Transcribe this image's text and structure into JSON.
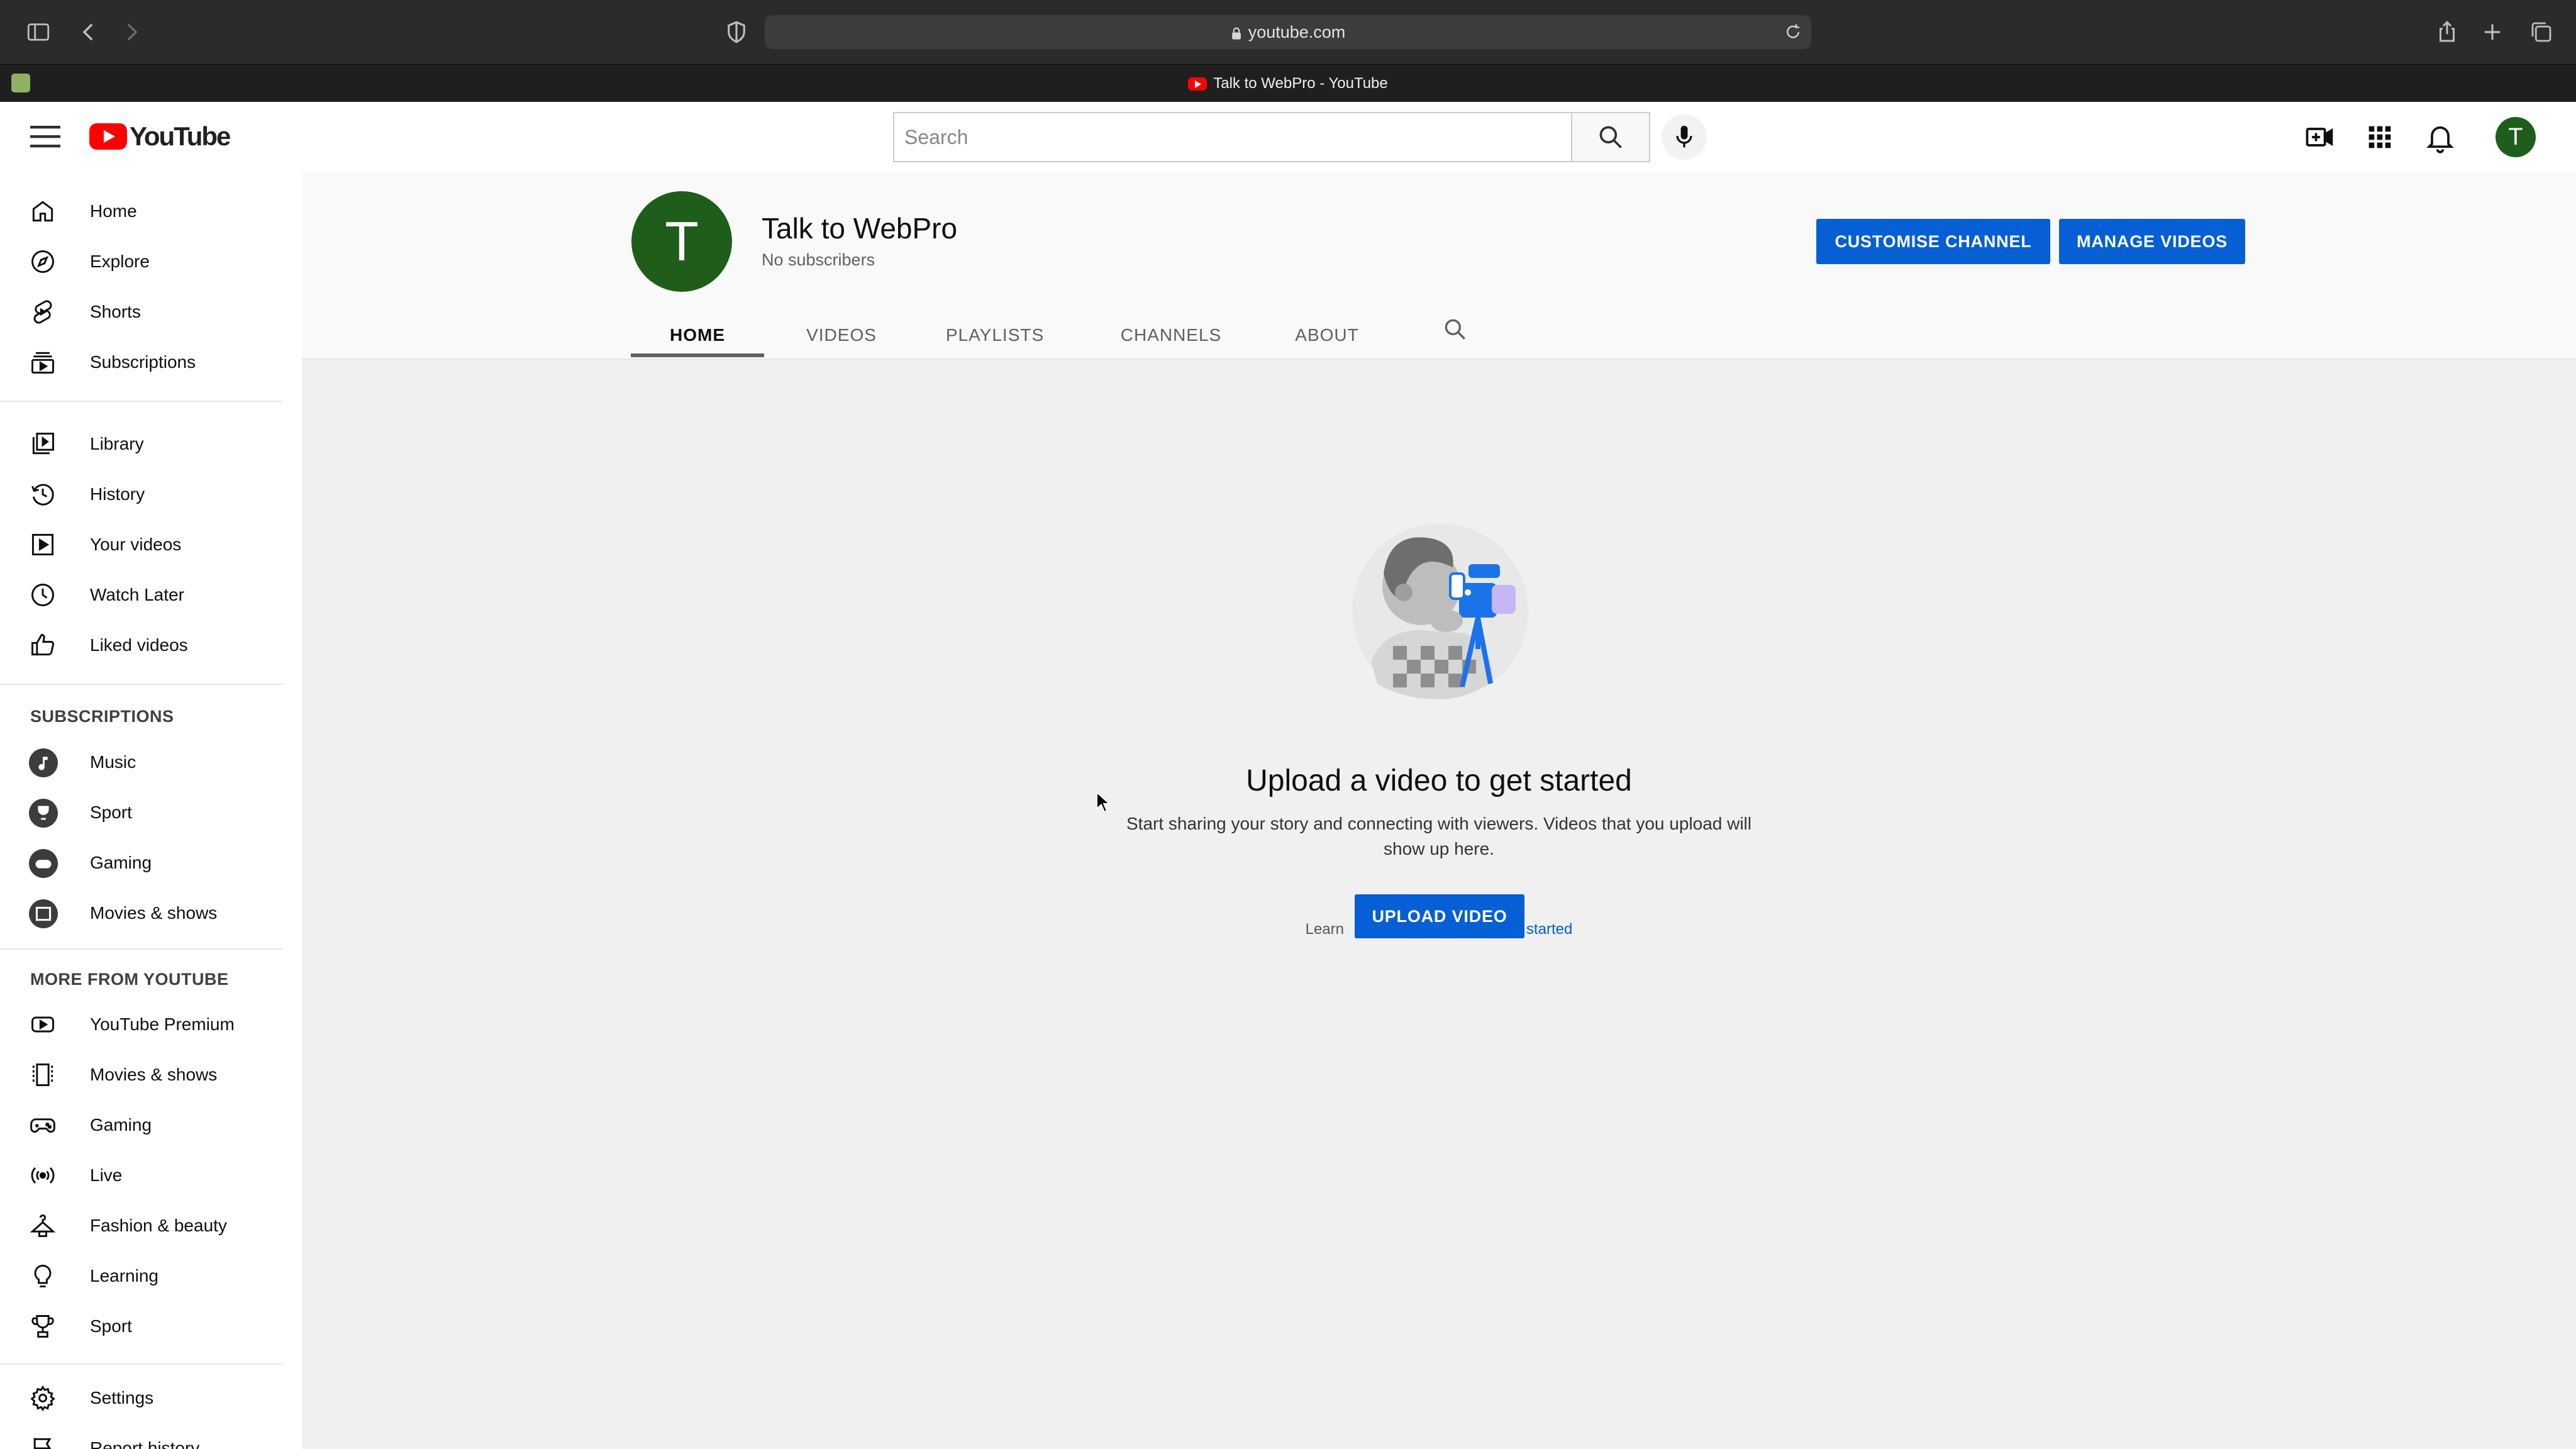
{
  "browser": {
    "url": "youtube.com",
    "tab_title": "Talk to WebPro - YouTube"
  },
  "masthead": {
    "logo_text": "YouTube",
    "search_placeholder": "Search",
    "avatar_letter": "T"
  },
  "sidebar": {
    "main": [
      {
        "label": "Home",
        "icon": "home-icon"
      },
      {
        "label": "Explore",
        "icon": "compass-icon"
      },
      {
        "label": "Shorts",
        "icon": "shorts-icon"
      },
      {
        "label": "Subscriptions",
        "icon": "subscriptions-icon"
      }
    ],
    "library": [
      {
        "label": "Library",
        "icon": "library-icon"
      },
      {
        "label": "History",
        "icon": "history-icon"
      },
      {
        "label": "Your videos",
        "icon": "your-videos-icon"
      },
      {
        "label": "Watch Later",
        "icon": "clock-icon"
      },
      {
        "label": "Liked videos",
        "icon": "thumbs-up-icon"
      }
    ],
    "subscriptions_heading": "SUBSCRIPTIONS",
    "subscriptions": [
      {
        "label": "Music",
        "icon": "music-channel-icon"
      },
      {
        "label": "Sport",
        "icon": "sport-channel-icon"
      },
      {
        "label": "Gaming",
        "icon": "gaming-channel-icon"
      },
      {
        "label": "Movies & shows",
        "icon": "movies-channel-icon"
      }
    ],
    "more_heading": "MORE FROM YOUTUBE",
    "more": [
      {
        "label": "YouTube Premium",
        "icon": "youtube-premium-icon"
      },
      {
        "label": "Movies & shows",
        "icon": "film-strip-icon"
      },
      {
        "label": "Gaming",
        "icon": "gamepad-icon"
      },
      {
        "label": "Live",
        "icon": "live-icon"
      },
      {
        "label": "Fashion & beauty",
        "icon": "hanger-icon"
      },
      {
        "label": "Learning",
        "icon": "lightbulb-icon"
      },
      {
        "label": "Sport",
        "icon": "trophy-icon"
      }
    ],
    "settings": [
      {
        "label": "Settings",
        "icon": "gear-icon"
      },
      {
        "label": "Report history",
        "icon": "flag-icon"
      }
    ]
  },
  "channel": {
    "avatar_letter": "T",
    "name": "Talk to WebPro",
    "subscribers": "No subscribers",
    "customise_label": "CUSTOMISE CHANNEL",
    "manage_label": "MANAGE VIDEOS",
    "tabs": [
      "HOME",
      "VIDEOS",
      "PLAYLISTS",
      "CHANNELS",
      "ABOUT"
    ],
    "active_tab": "HOME"
  },
  "empty_state": {
    "title": "Upload a video to get started",
    "description": "Start sharing your story and connecting with viewers. Videos that you upload will show up here.",
    "upload_label": "UPLOAD VIDEO",
    "learn_more_prefix": "Learn",
    "learn_more_link": "started"
  },
  "colors": {
    "brand_red": "#ff0000",
    "action_blue": "#065fd4",
    "avatar_green": "#1e5e1a"
  }
}
